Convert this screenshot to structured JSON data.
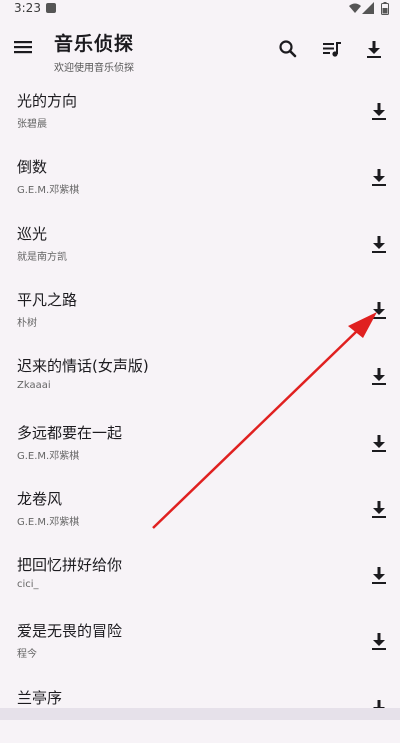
{
  "status_bar": {
    "time": "3:23"
  },
  "app_bar": {
    "title": "音乐侦探",
    "subtitle": "欢迎使用音乐侦探",
    "icons": [
      "menu-icon",
      "search-icon",
      "playlist-icon",
      "download-icon"
    ]
  },
  "songs": [
    {
      "title": "光的方向",
      "artist": "张碧晨"
    },
    {
      "title": "倒数",
      "artist": "G.E.M.邓紫棋"
    },
    {
      "title": "巡光",
      "artist": "就是南方凯"
    },
    {
      "title": "平凡之路",
      "artist": "朴树"
    },
    {
      "title": "迟来的情话(女声版)",
      "artist": "Zkaaai"
    },
    {
      "title": "多远都要在一起",
      "artist": "G.E.M.邓紫棋"
    },
    {
      "title": "龙卷风",
      "artist": "G.E.M.邓紫棋"
    },
    {
      "title": "把回忆拼好给你",
      "artist": "cici_"
    },
    {
      "title": "爱是无畏的冒险",
      "artist": "程今"
    },
    {
      "title": "兰亭序",
      "artist": ""
    }
  ],
  "colors": {
    "annotation_arrow": "#e02020",
    "background": "#f7f3f7"
  }
}
